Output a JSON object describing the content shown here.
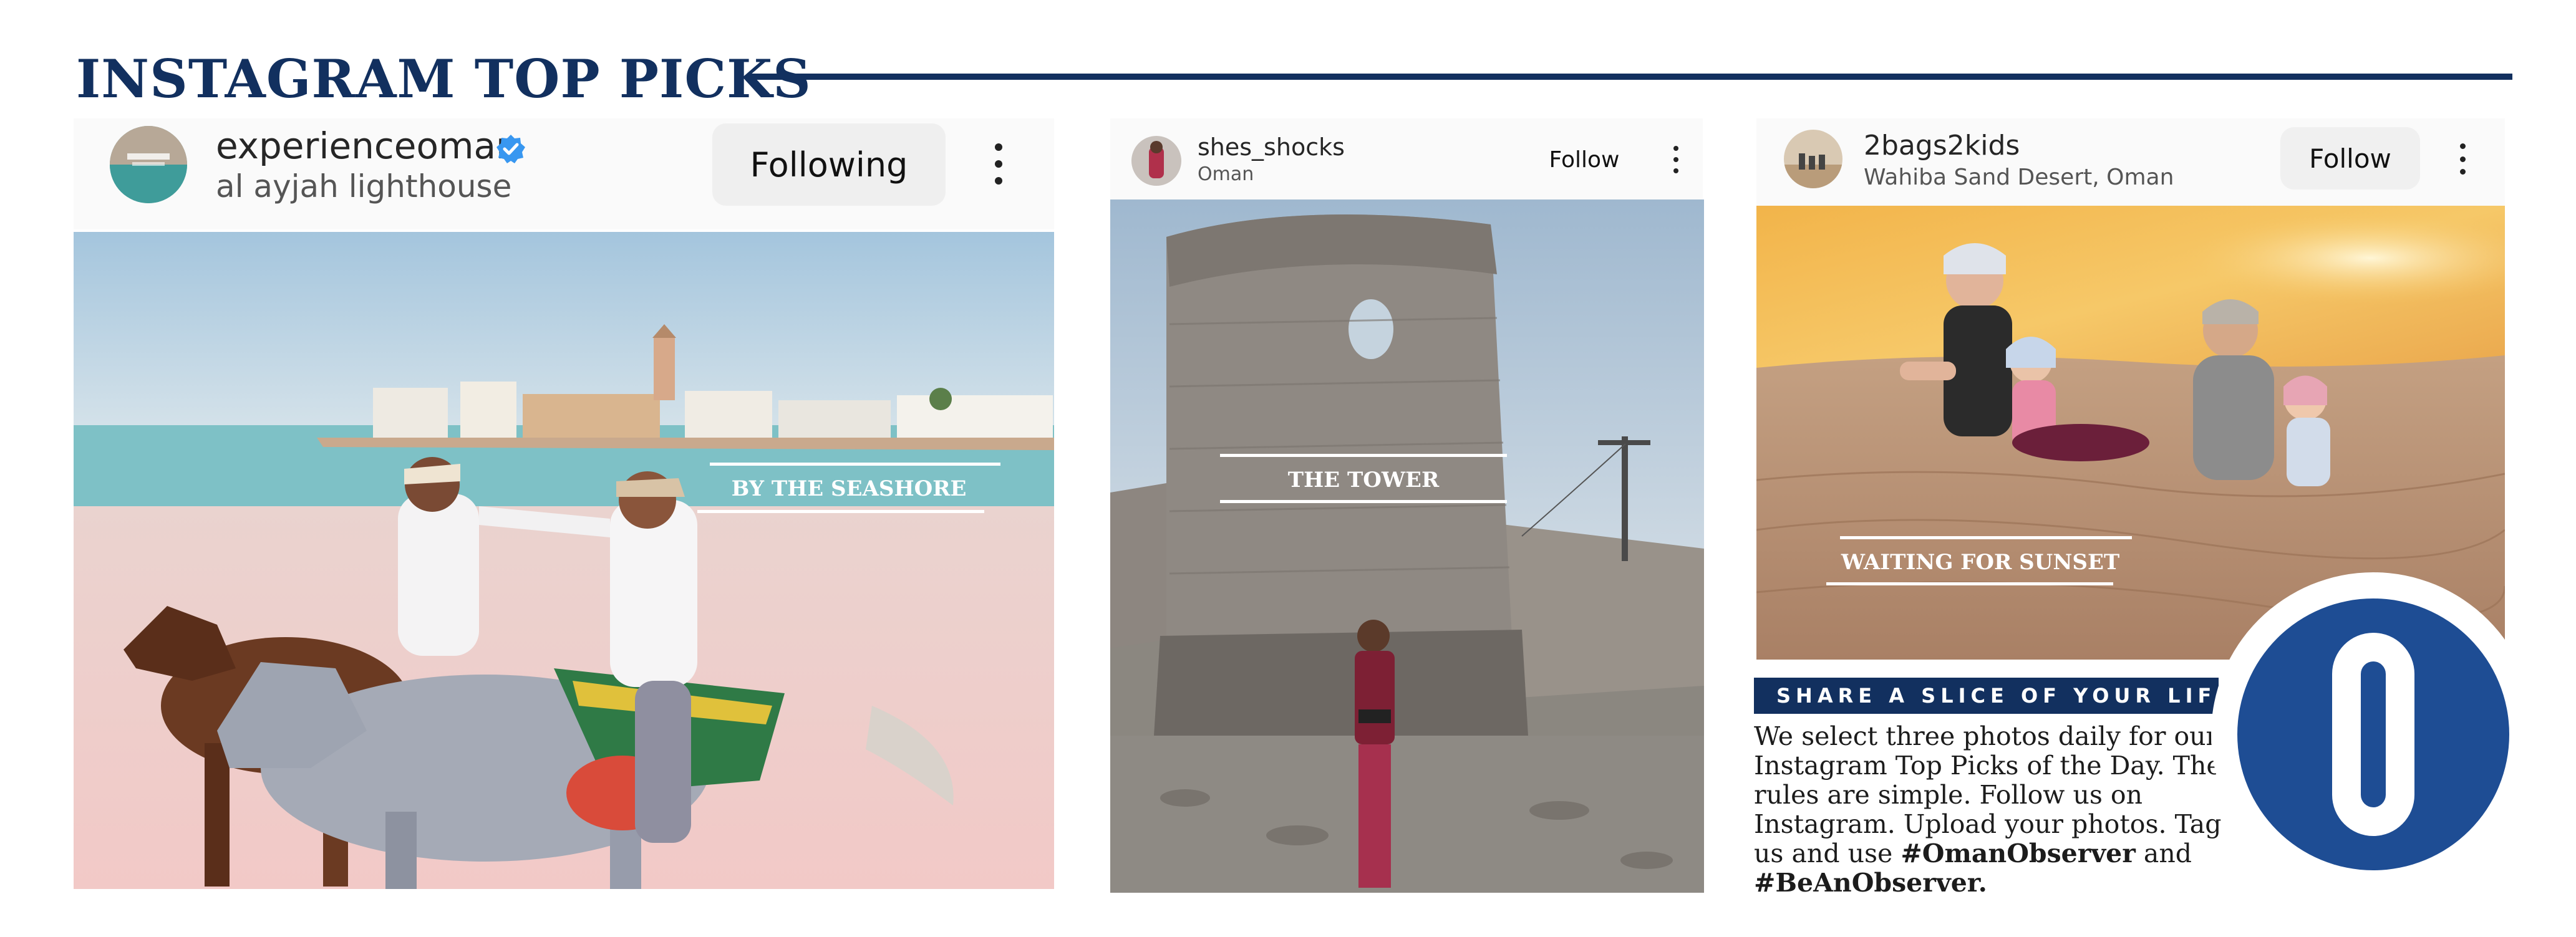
{
  "section_title": "INSTAGRAM TOP PICKS",
  "colors": {
    "navy": "#12305f",
    "logo_blue": "#1e4d94",
    "verified_blue": "#3897f0",
    "header_bg": "#fafafa"
  },
  "posts": [
    {
      "username": "experienceoman",
      "verified": true,
      "location": "al ayjah lighthouse",
      "follow_label": "Following",
      "caption": "BY THE SEASHORE",
      "icons": [
        "verified-badge-icon",
        "more-options-icon"
      ]
    },
    {
      "username": "shes_shocks",
      "location": "Oman",
      "follow_label": "Follow",
      "caption": "THE TOWER",
      "icons": [
        "more-options-icon"
      ]
    },
    {
      "username": "2bags2kids",
      "location": "Wahiba Sand Desert, Oman",
      "follow_label": "Follow",
      "caption": "WAITING FOR SUNSET",
      "icons": [
        "more-options-icon"
      ]
    }
  ],
  "share": {
    "banner": "SHARE A SLICE OF YOUR LIFE",
    "text_1": "We select three photos daily for our Instagram Top Picks of the Day. The rules are simple. Follow us on Instagram. Upload your photos. Tag us and use",
    "hashtag_1": "#OmanObserver",
    "text_2": "and",
    "hashtag_2": "#BeAnObserver."
  },
  "logo": {
    "letter": "O",
    "icon": "observer-logo-icon"
  }
}
